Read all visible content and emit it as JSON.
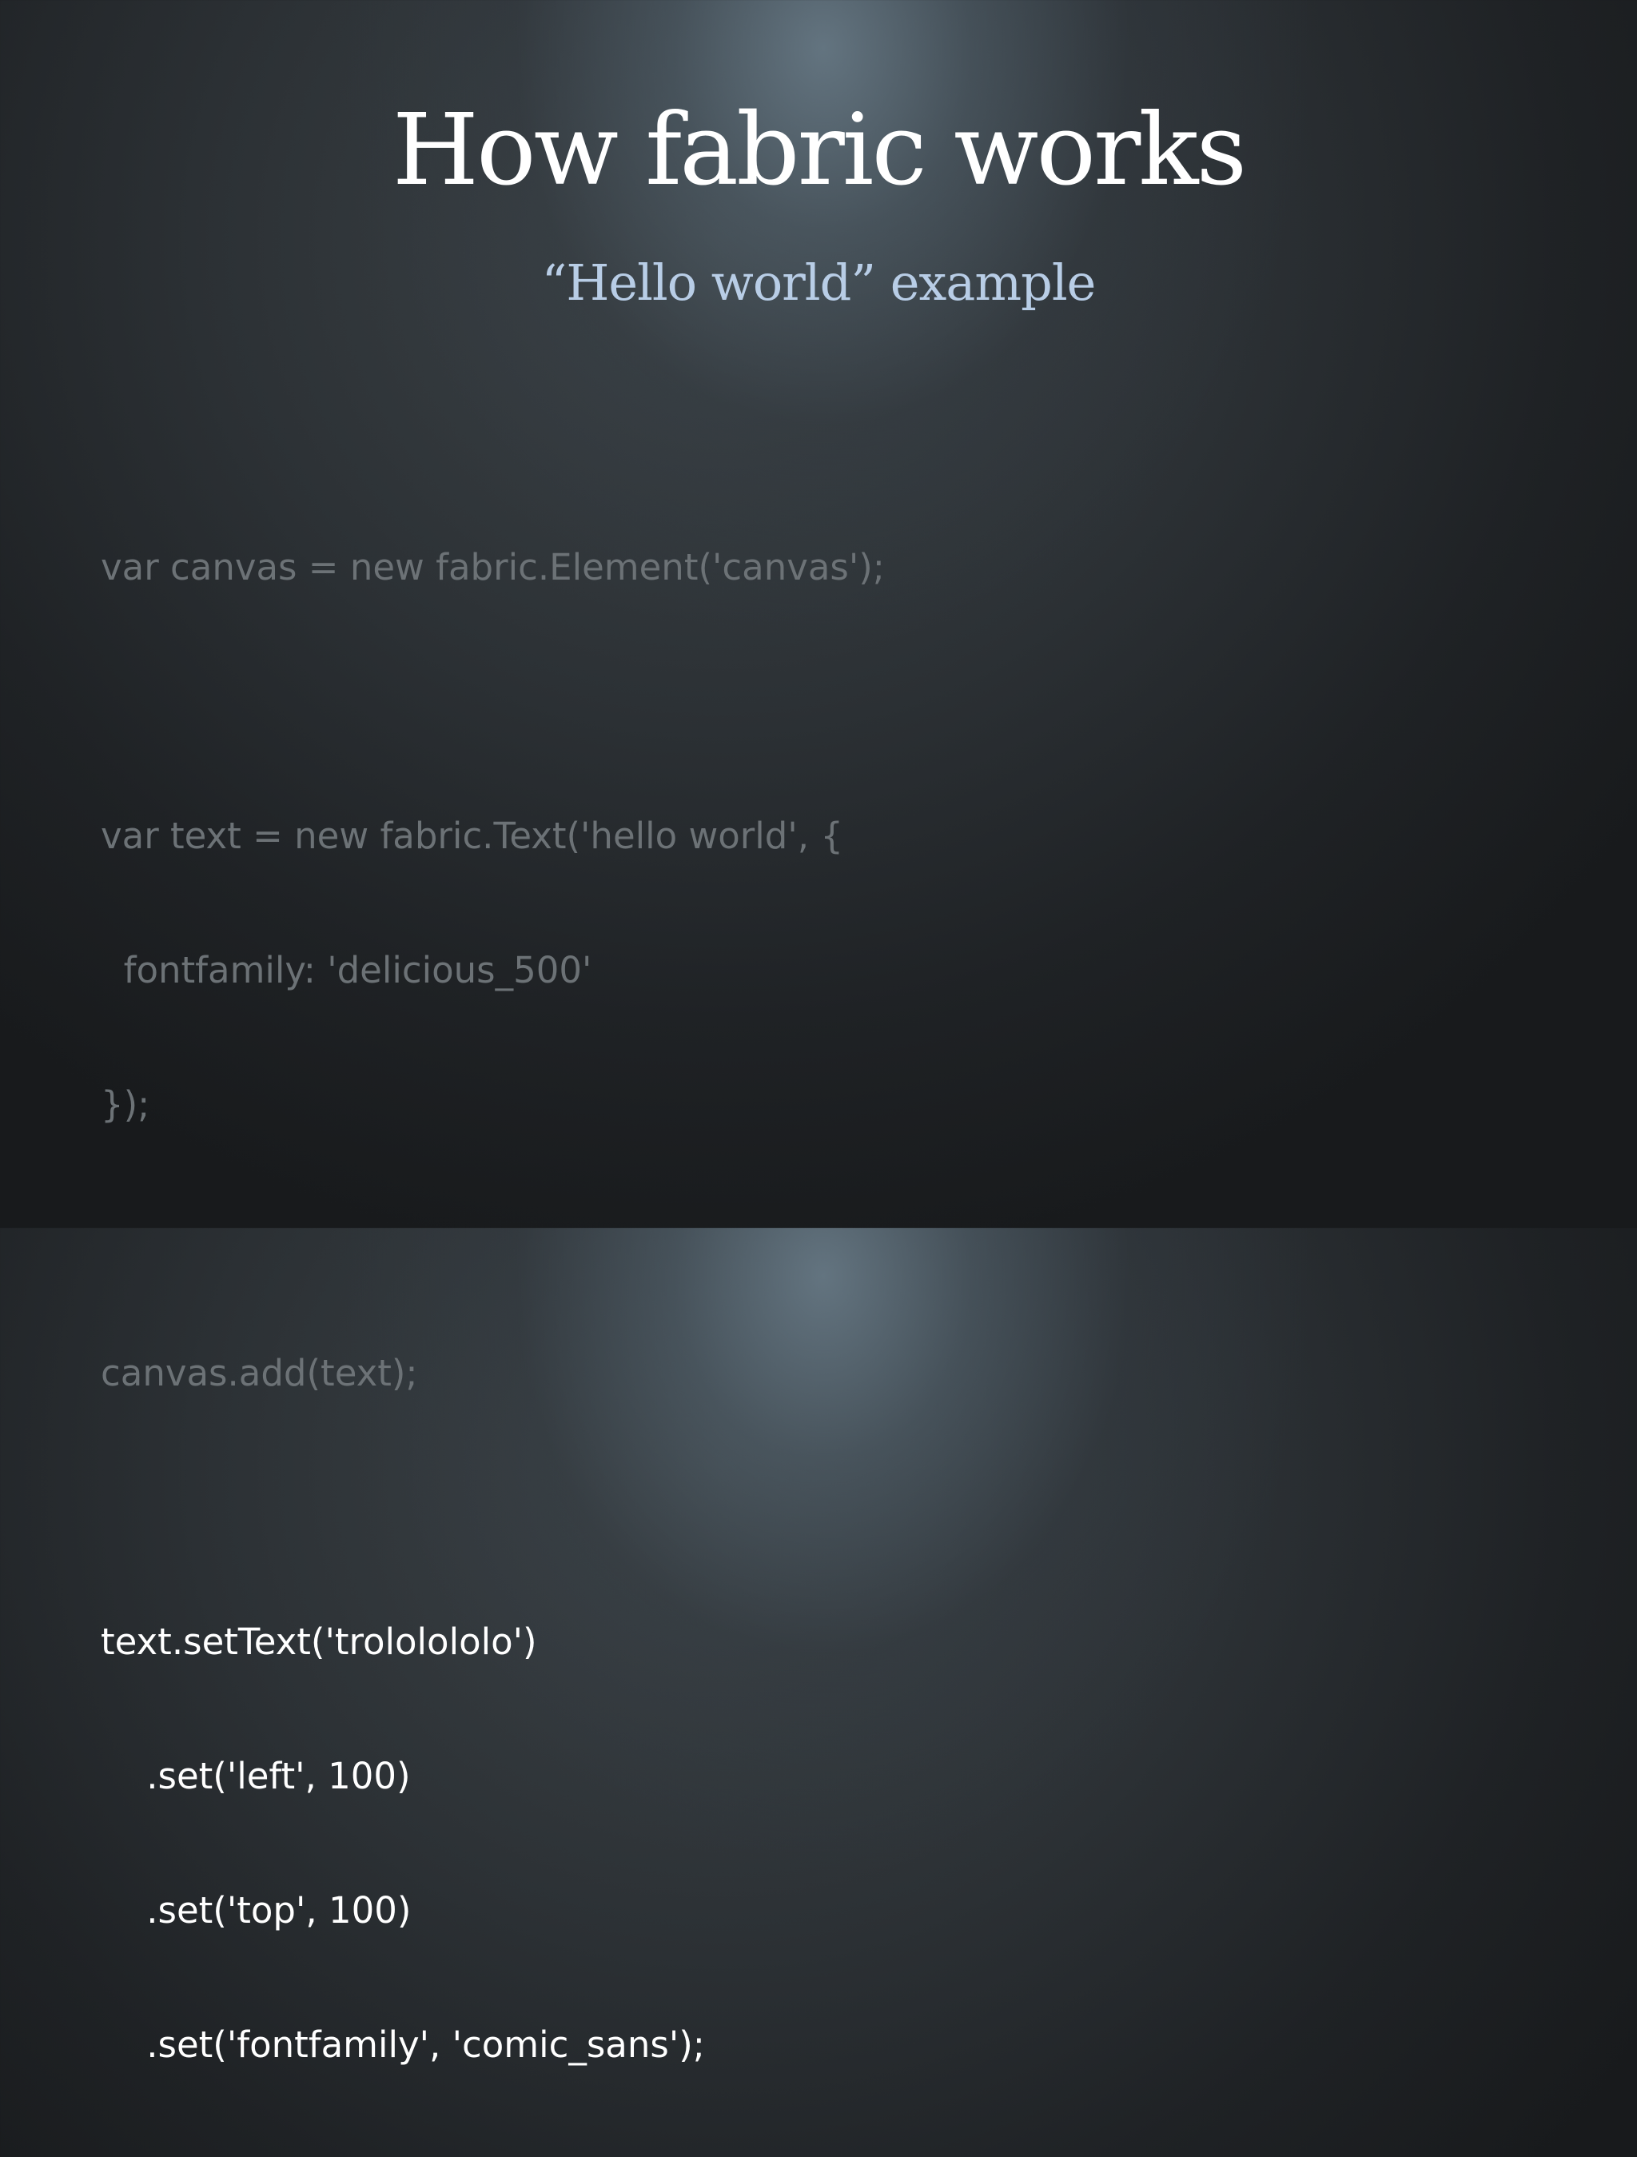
{
  "slide": {
    "title": "How fabric works",
    "subtitle": "“Hello world” example",
    "code": {
      "dim_lines": [
        "var canvas = new fabric.Element('canvas');",
        "",
        "var text = new fabric.Text('hello world', {",
        "  fontfamily: 'delicious_500'",
        "});",
        "",
        "canvas.add(text);"
      ],
      "spacer": "",
      "highlight_lines": [
        "text.setText('trololololo')",
        "    .set('left', 100)",
        "    .set('top', 100)",
        "    .set('fontfamily', 'comic_sans');"
      ]
    },
    "colors": {
      "title": "#ffffff",
      "subtitle": "#b8cde6",
      "code_dim": "#6c7276",
      "code_highlight": "#ffffff",
      "background": "#1b1d1f"
    }
  }
}
